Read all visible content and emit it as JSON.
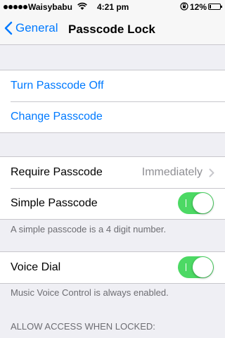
{
  "status_bar": {
    "carrier": "Waisybabu",
    "time": "4:21 pm",
    "battery_percent": "12%",
    "battery_level": 0.12,
    "icons": [
      "signal-dots-icon",
      "wifi-icon",
      "rotation-lock-icon",
      "battery-icon"
    ]
  },
  "nav": {
    "back_label": "General",
    "title": "Passcode Lock"
  },
  "passcode_actions": {
    "turn_off_label": "Turn Passcode Off",
    "change_label": "Change Passcode"
  },
  "settings": {
    "require_passcode_label": "Require Passcode",
    "require_passcode_value": "Immediately",
    "simple_passcode_label": "Simple Passcode",
    "simple_passcode_on": true,
    "simple_passcode_note": "A simple passcode is a 4 digit number."
  },
  "voice": {
    "voice_dial_label": "Voice Dial",
    "voice_dial_on": true,
    "voice_note": "Music Voice Control is always enabled."
  },
  "allow_access": {
    "header": "ALLOW ACCESS WHEN LOCKED:"
  },
  "colors": {
    "accent": "#007aff",
    "toggle_on": "#4cd964",
    "background": "#efeff4",
    "secondary_text": "#8e8e93"
  }
}
